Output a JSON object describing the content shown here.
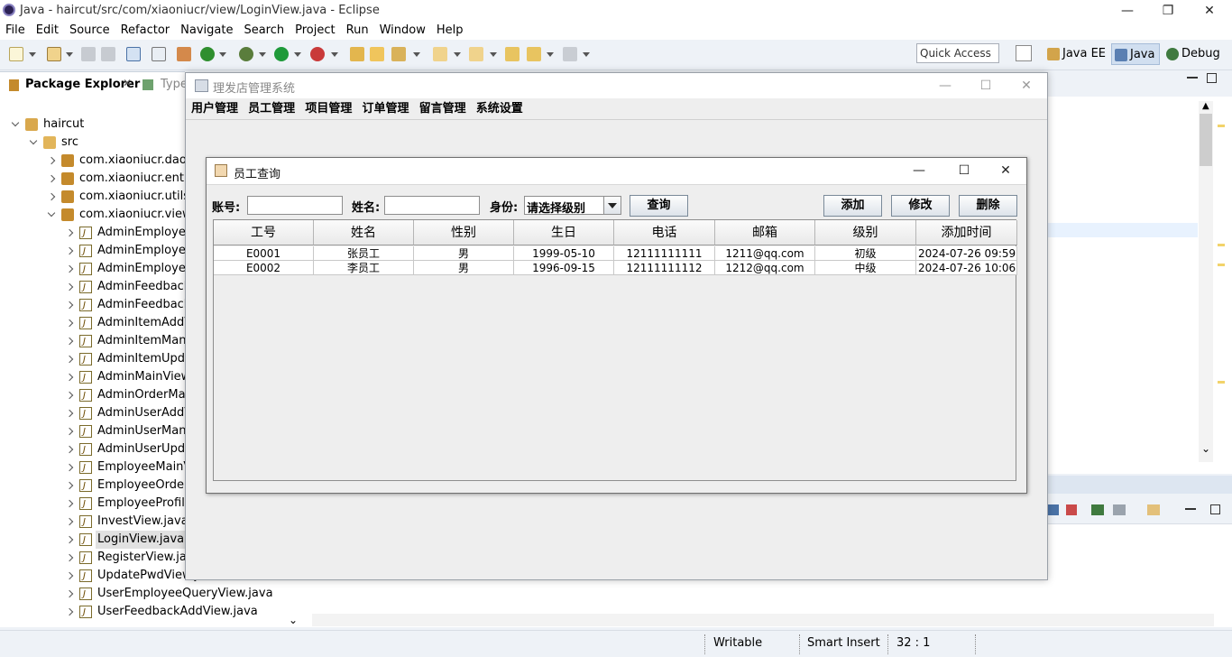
{
  "eclipse": {
    "title": "Java - haircut/src/com/xiaoniucr/view/LoginView.java - Eclipse",
    "menu": [
      "File",
      "Edit",
      "Source",
      "Refactor",
      "Navigate",
      "Search",
      "Project",
      "Run",
      "Window",
      "Help"
    ],
    "quick_access": "Quick Access",
    "perspectives": [
      "Java EE",
      "Java",
      "Debug"
    ],
    "window_controls": {
      "minimize": "—",
      "restore": "❐",
      "close": "✕"
    },
    "package_explorer": {
      "tab_label": "Package Explorer",
      "type_tab_label": "Type",
      "tree": [
        {
          "label": "haircut",
          "level": 0,
          "icon": "project-icon",
          "expanded": true
        },
        {
          "label": "src",
          "level": 1,
          "icon": "source-folder-icon",
          "expanded": true
        },
        {
          "label": "com.xiaoniucr.dao",
          "level": 2,
          "icon": "package-icon",
          "expanded": false
        },
        {
          "label": "com.xiaoniucr.entity",
          "level": 2,
          "icon": "package-icon",
          "expanded": false
        },
        {
          "label": "com.xiaoniucr.utils",
          "level": 2,
          "icon": "package-icon",
          "expanded": false
        },
        {
          "label": "com.xiaoniucr.view",
          "level": 2,
          "icon": "package-icon",
          "expanded": true
        },
        {
          "label": "AdminEmployeeA",
          "level": 3,
          "icon": "java-file-icon"
        },
        {
          "label": "AdminEmployeeM",
          "level": 3,
          "icon": "java-file-icon"
        },
        {
          "label": "AdminEmployeeU",
          "level": 3,
          "icon": "java-file-icon"
        },
        {
          "label": "AdminFeedbackM",
          "level": 3,
          "icon": "java-file-icon"
        },
        {
          "label": "AdminFeedbackR",
          "level": 3,
          "icon": "java-file-icon"
        },
        {
          "label": "AdminItemAddVi",
          "level": 3,
          "icon": "java-file-icon"
        },
        {
          "label": "AdminItemManag",
          "level": 3,
          "icon": "java-file-icon"
        },
        {
          "label": "AdminItemUpdat",
          "level": 3,
          "icon": "java-file-icon"
        },
        {
          "label": "AdminMainView.j",
          "level": 3,
          "icon": "java-file-icon"
        },
        {
          "label": "AdminOrderMana",
          "level": 3,
          "icon": "java-file-icon"
        },
        {
          "label": "AdminUserAddVi",
          "level": 3,
          "icon": "java-file-icon"
        },
        {
          "label": "AdminUserManag",
          "level": 3,
          "icon": "java-file-icon"
        },
        {
          "label": "AdminUserUpdat",
          "level": 3,
          "icon": "java-file-icon"
        },
        {
          "label": "EmployeeMainVie",
          "level": 3,
          "icon": "java-file-icon"
        },
        {
          "label": "EmployeeOrderM",
          "level": 3,
          "icon": "java-file-icon"
        },
        {
          "label": "EmployeeProfileV",
          "level": 3,
          "icon": "java-file-icon"
        },
        {
          "label": "InvestView.java",
          "level": 3,
          "icon": "java-file-icon"
        },
        {
          "label": "LoginView.java",
          "level": 3,
          "icon": "java-file-icon",
          "selected": true
        },
        {
          "label": "RegisterView.java",
          "level": 3,
          "icon": "java-file-icon"
        },
        {
          "label": "UpdatePwdView.java",
          "level": 3,
          "icon": "java-file-icon"
        },
        {
          "label": "UserEmployeeQueryView.java",
          "level": 3,
          "icon": "java-file-icon"
        },
        {
          "label": "UserFeedbackAddView.java",
          "level": 3,
          "icon": "java-file-icon"
        }
      ]
    },
    "status": {
      "writable": "Writable",
      "insert_mode": "Smart Insert",
      "position": "32 : 1"
    }
  },
  "app": {
    "title": "理发店管理系统",
    "menu": [
      "用户管理",
      "员工管理",
      "项目管理",
      "订单管理",
      "留言管理",
      "系统设置"
    ],
    "window_controls": {
      "minimize": "—",
      "maximize": "☐",
      "close": "✕"
    }
  },
  "dialog": {
    "title": "员工查询",
    "window_controls": {
      "minimize": "—",
      "maximize": "☐",
      "close": "✕"
    },
    "form": {
      "account_label": "账号:",
      "account_value": "",
      "name_label": "姓名:",
      "name_value": "",
      "role_label": "身份:",
      "role_selected": "请选择级别",
      "query_button": "查询",
      "add_button": "添加",
      "edit_button": "修改",
      "delete_button": "删除"
    },
    "table": {
      "columns": [
        "工号",
        "姓名",
        "性别",
        "生日",
        "电话",
        "邮箱",
        "级别",
        "添加时间"
      ],
      "rows": [
        [
          "E0001",
          "张员工",
          "男",
          "1999-05-10",
          "12111111111",
          "1211@qq.com",
          "初级",
          "2024-07-26 09:59..."
        ],
        [
          "E0002",
          "李员工",
          "男",
          "1996-09-15",
          "12111111112",
          "1212@qq.com",
          "中级",
          "2024-07-26 10:06..."
        ]
      ]
    }
  }
}
